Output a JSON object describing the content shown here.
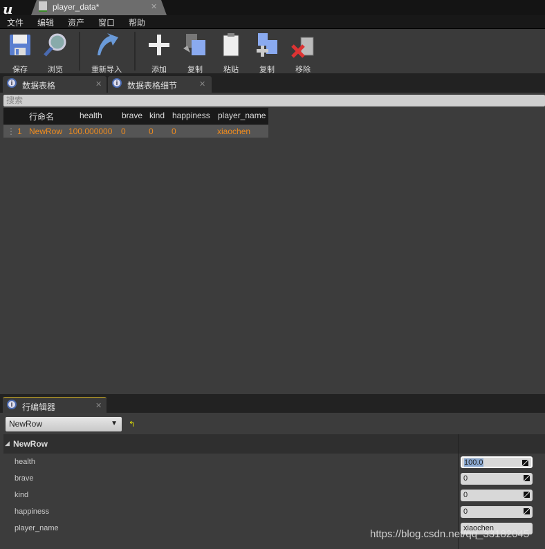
{
  "window": {
    "doc_tab": "player_data*"
  },
  "menu": [
    "文件",
    "编辑",
    "资产",
    "窗口",
    "帮助"
  ],
  "toolbar": [
    {
      "label": "保存",
      "icon": "save-icon"
    },
    {
      "label": "浏览",
      "icon": "browse-icon"
    },
    {
      "label": "重新导入",
      "icon": "reimport-icon"
    },
    {
      "label": "添加",
      "icon": "add-icon"
    },
    {
      "label": "复制",
      "icon": "copy-icon"
    },
    {
      "label": "粘贴",
      "icon": "paste-icon"
    },
    {
      "label": "复制",
      "icon": "duplicate-icon"
    },
    {
      "label": "移除",
      "icon": "remove-icon"
    }
  ],
  "tabs": [
    {
      "label": "数据表格"
    },
    {
      "label": "数据表格细节"
    }
  ],
  "search": {
    "placeholder": "搜索"
  },
  "table": {
    "columns": [
      "行命名",
      "health",
      "brave",
      "kind",
      "happiness",
      "player_name"
    ],
    "rows": [
      {
        "index": "1",
        "cells": [
          "NewRow",
          "100.000000",
          "0",
          "0",
          "0",
          "xiaochen"
        ]
      }
    ]
  },
  "row_editor": {
    "tab": "行编辑器",
    "selected_row": "NewRow",
    "section": "NewRow",
    "properties": [
      {
        "name": "health",
        "value": "100.0"
      },
      {
        "name": "brave",
        "value": "0"
      },
      {
        "name": "kind",
        "value": "0"
      },
      {
        "name": "happiness",
        "value": "0"
      },
      {
        "name": "player_name",
        "value": "xiaochen"
      }
    ]
  },
  "watermark": "https://blog.csdn.net/qq_33182045",
  "colors": {
    "accent": "#f08c1e",
    "background": "#3c3c3c"
  }
}
